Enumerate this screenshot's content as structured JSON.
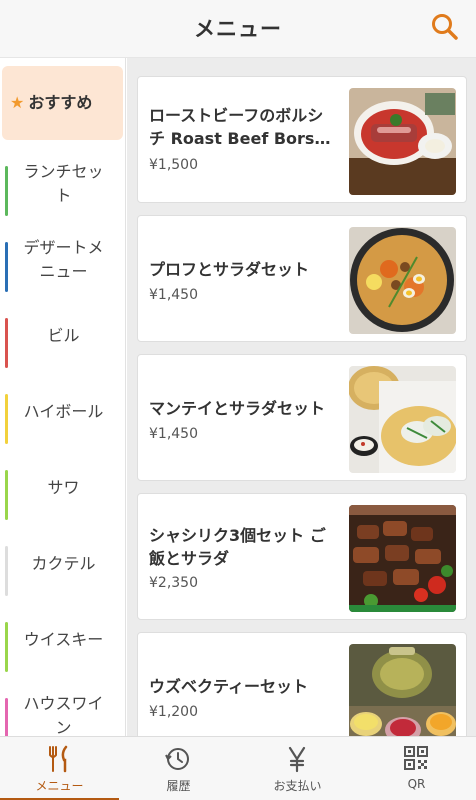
{
  "header": {
    "title": "メニュー",
    "search_icon": "search-icon"
  },
  "sidebar": {
    "items": [
      {
        "label": "おすすめ",
        "active": true,
        "icon": "star-icon",
        "bar_color": ""
      },
      {
        "label": "ランチセット",
        "bar_color": "#5cb85c"
      },
      {
        "label": "デザートメニュー",
        "bar_color": "#2a6fb5"
      },
      {
        "label": "ビル",
        "bar_color": "#d9534f"
      },
      {
        "label": "ハイボール",
        "bar_color": "#f2d13c"
      },
      {
        "label": "サワ",
        "bar_color": "#9ad64b"
      },
      {
        "label": "カクテル",
        "bar_color": "#dddddd"
      },
      {
        "label": "ウイスキー",
        "bar_color": "#9ad64b"
      },
      {
        "label": "ハウスワイン",
        "bar_color": "#e466b0"
      }
    ]
  },
  "items": [
    {
      "name": "ローストビーフのボルシチ Roast Beef Bors…",
      "price": "¥1,500",
      "image": "roast-beef-borscht-photo"
    },
    {
      "name": "プロフとサラダセット",
      "price": "¥1,450",
      "image": "plov-salad-photo"
    },
    {
      "name": "マンテイとサラダセット",
      "price": "¥1,450",
      "image": "manti-salad-photo"
    },
    {
      "name": "シャシリク3個セット ご飯とサラダ",
      "price": "¥2,350",
      "image": "shashlik-set-photo"
    },
    {
      "name": "ウズベクティーセット",
      "price": "¥1,200",
      "image": "uzbek-tea-photo"
    }
  ],
  "tabs": [
    {
      "label": "メニュー",
      "icon": "fork-knife-icon",
      "active": true
    },
    {
      "label": "履歴",
      "icon": "history-icon"
    },
    {
      "label": "お支払い",
      "icon": "yen-icon"
    },
    {
      "label": "QR",
      "icon": "qr-code-icon"
    }
  ],
  "colors": {
    "accent": "#b45a12",
    "active_category_bg": "#fde6d4",
    "star": "#f29a2e",
    "content_bg": "#ececec"
  }
}
